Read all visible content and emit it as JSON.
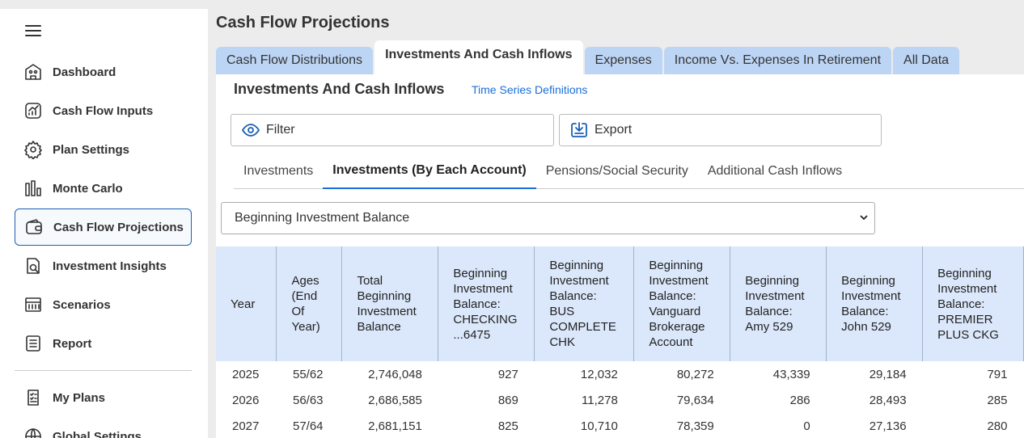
{
  "sidebar": {
    "items": [
      {
        "label": "Dashboard",
        "icon": "home-icon"
      },
      {
        "label": "Cash Flow Inputs",
        "icon": "chart-icon"
      },
      {
        "label": "Plan Settings",
        "icon": "gear-icon"
      },
      {
        "label": "Monte Carlo",
        "icon": "bar-chart-icon"
      },
      {
        "label": "Cash Flow Projections",
        "icon": "wallet-icon",
        "active": true
      },
      {
        "label": "Investment Insights",
        "icon": "document-search-icon"
      },
      {
        "label": "Scenarios",
        "icon": "scenarios-icon"
      },
      {
        "label": "Report",
        "icon": "report-icon"
      }
    ],
    "secondary_items": [
      {
        "label": "My Plans",
        "icon": "checklist-icon"
      },
      {
        "label": "Global Settings",
        "icon": "globe-icon"
      }
    ]
  },
  "page": {
    "title": "Cash Flow Projections"
  },
  "tabs": [
    {
      "label": "Cash Flow Distributions"
    },
    {
      "label": "Investments And Cash Inflows",
      "active": true
    },
    {
      "label": "Expenses"
    },
    {
      "label": "Income Vs. Expenses In Retirement"
    },
    {
      "label": "All Data"
    }
  ],
  "section": {
    "title": "Investments And Cash Inflows",
    "link": "Time Series Definitions",
    "filter_label": "Filter",
    "export_label": "Export"
  },
  "subtabs": [
    {
      "label": "Investments"
    },
    {
      "label": "Investments (By Each Account)",
      "active": true
    },
    {
      "label": "Pensions/Social Security"
    },
    {
      "label": "Additional Cash Inflows"
    }
  ],
  "select": {
    "value": "Beginning Investment Balance"
  },
  "table": {
    "headers": [
      "Year",
      "Ages (End Of Year)",
      "Total Beginning Investment Balance",
      "Beginning Investment Balance: CHECKING ...6475",
      "Beginning Investment Balance: BUS COMPLETE CHK",
      "Beginning Investment Balance: Vanguard Brokerage Account",
      "Beginning Investment Balance: Amy 529",
      "Beginning Investment Balance: John 529",
      "Beginning Investment Balance: PREMIER PLUS CKG"
    ],
    "rows": [
      [
        "2025",
        "55/62",
        "2,746,048",
        "927",
        "12,032",
        "80,272",
        "43,339",
        "29,184",
        "791"
      ],
      [
        "2026",
        "56/63",
        "2,686,585",
        "869",
        "11,278",
        "79,634",
        "286",
        "28,493",
        "285"
      ],
      [
        "2027",
        "57/64",
        "2,681,151",
        "825",
        "10,710",
        "78,359",
        "0",
        "27,136",
        "280"
      ]
    ]
  }
}
